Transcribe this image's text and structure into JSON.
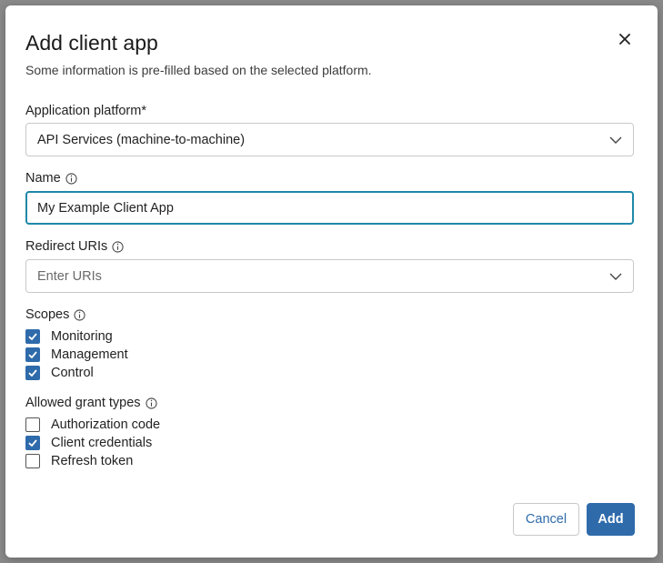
{
  "dialog": {
    "title": "Add client app",
    "subtitle": "Some information is pre-filled based on the selected platform."
  },
  "platform": {
    "label": "Application platform*",
    "value": "API Services (machine-to-machine)"
  },
  "name": {
    "label": "Name",
    "value": "My Example Client App"
  },
  "redirect": {
    "label": "Redirect URIs",
    "placeholder": "Enter URIs"
  },
  "scopes": {
    "label": "Scopes",
    "items": [
      {
        "label": "Monitoring",
        "checked": true
      },
      {
        "label": "Management",
        "checked": true
      },
      {
        "label": "Control",
        "checked": true
      }
    ]
  },
  "grants": {
    "label": "Allowed grant types",
    "items": [
      {
        "label": "Authorization code",
        "checked": false
      },
      {
        "label": "Client credentials",
        "checked": true
      },
      {
        "label": "Refresh token",
        "checked": false
      }
    ]
  },
  "buttons": {
    "cancel": "Cancel",
    "add": "Add"
  },
  "colors": {
    "accent": "#2f6bab",
    "focus": "#1f88a8"
  }
}
